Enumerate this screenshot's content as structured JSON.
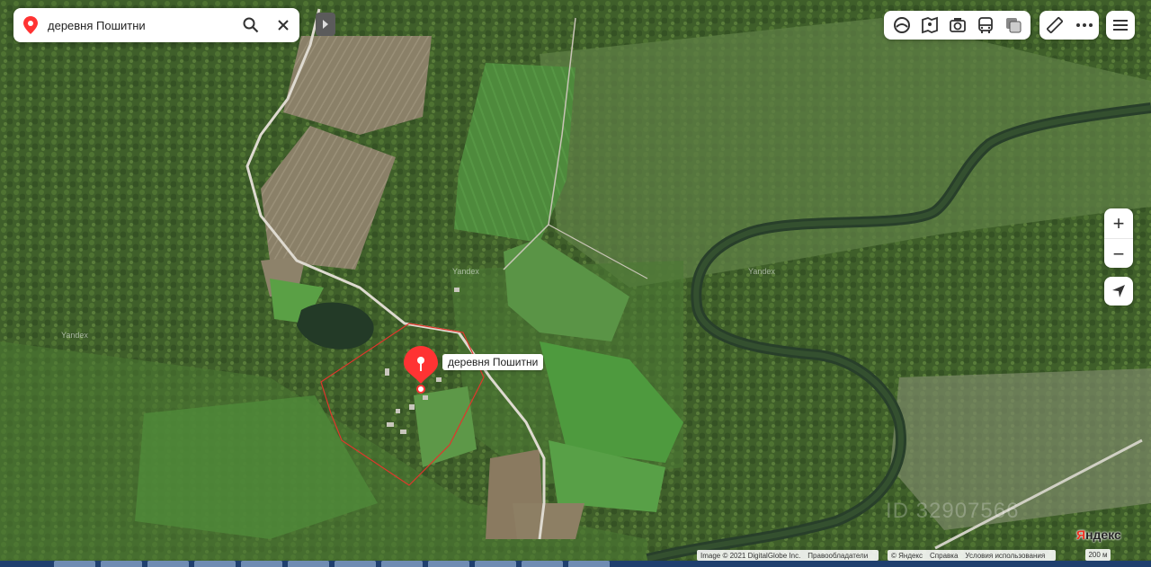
{
  "search": {
    "query": "деревня Пошитни",
    "pin_icon": "location-pin-icon",
    "search_icon": "search-icon",
    "clear_icon": "close-icon"
  },
  "toolbar": {
    "tools": [
      "layers-icon",
      "panorama-icon",
      "photo-icon",
      "transport-icon",
      "traffic-icon"
    ],
    "extra": [
      "ruler-icon",
      "more-icon"
    ],
    "menu_icon": "hamburger-menu-icon"
  },
  "zoom": {
    "in_label": "+",
    "out_label": "−"
  },
  "marker": {
    "label": "деревня Пошитни"
  },
  "watermarks": [
    "Yandex",
    "Yandex",
    "Yandex"
  ],
  "overlay_id": "ID 32907566",
  "brand": {
    "first": "Я",
    "rest": "ндекс"
  },
  "attribution": {
    "imagery": "Image © 2021 DigitalGlobe Inc.",
    "rights": "Правообладатели",
    "copyright": "© Яндекс",
    "help": "Справка",
    "terms": "Условия использования"
  },
  "scale": {
    "label": "200 м"
  },
  "colors": {
    "marker": "#f33",
    "boundary": "#e0362c",
    "road": "#e8e8e8",
    "river": "#2f4a2a"
  }
}
